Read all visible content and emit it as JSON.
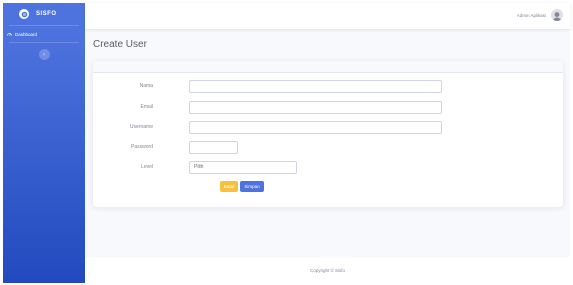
{
  "sidebar": {
    "brand": "SISFO",
    "items": [
      {
        "label": "Dashboard",
        "icon": "tachometer-icon"
      }
    ],
    "toggle_icon": "chevron-left-icon"
  },
  "topbar": {
    "user_name": "Admin Aplikasi",
    "avatar_icon": "avatar-icon"
  },
  "page": {
    "title": "Create User"
  },
  "form": {
    "fields": [
      {
        "label": "Nama",
        "value": ""
      },
      {
        "label": "Email",
        "value": ""
      },
      {
        "label": "Username",
        "value": ""
      },
      {
        "label": "Password",
        "value": ""
      },
      {
        "label": "Level",
        "value": "Pilih"
      }
    ],
    "buttons": {
      "back": "Batal",
      "save": "Simpan"
    }
  },
  "footer": {
    "text": "Copyright © Sisfo"
  },
  "colors": {
    "primary": "#4e73df",
    "warning": "#f6c23e",
    "sidebar_end": "#224abe"
  }
}
